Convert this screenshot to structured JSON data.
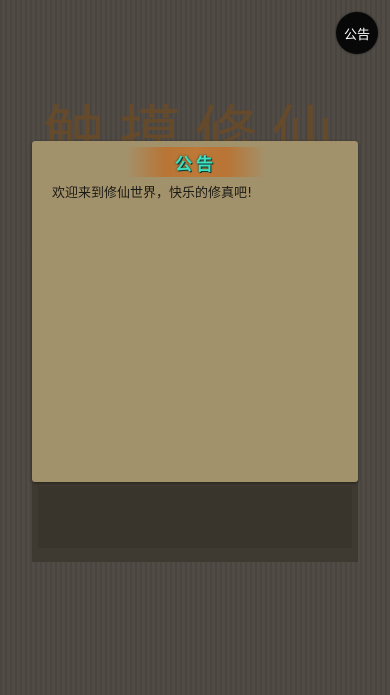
{
  "background": {
    "title": "触摸修仙"
  },
  "notice_button": {
    "label": "公告"
  },
  "modal": {
    "title": "公告",
    "message": "欢迎来到修仙世界，快乐的修真吧!"
  },
  "colors": {
    "page_background": "#4d4842",
    "modal_background": "#a2926c",
    "title_accent": "#3ee0c0",
    "header_banner": "#be7837"
  }
}
